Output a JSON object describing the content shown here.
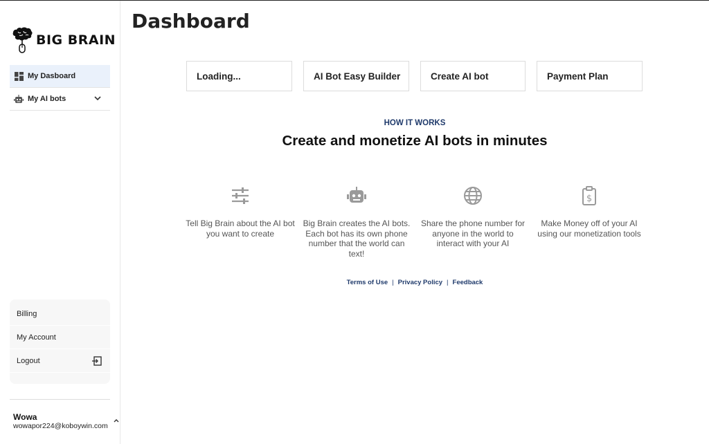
{
  "brand": {
    "name": "BIG BRAIN"
  },
  "sidebar": {
    "items": [
      {
        "label": "My Dasboard",
        "icon": "dashboard-icon"
      },
      {
        "label": "My AI bots",
        "icon": "robot-icon"
      }
    ],
    "bottom_items": [
      {
        "label": "Billing"
      },
      {
        "label": "My Account"
      },
      {
        "label": "Logout",
        "icon": "logout-icon"
      }
    ],
    "user": {
      "name": "Wowa",
      "email": "wowapor224@koboywin.com"
    }
  },
  "main": {
    "title": "Dashboard",
    "buttons": [
      {
        "label": "Loading..."
      },
      {
        "label": "AI Bot Easy Builder"
      },
      {
        "label": "Create AI bot"
      },
      {
        "label": "Payment Plan"
      }
    ],
    "how_it_works": {
      "label": "HOW IT WORKS",
      "heading": "Create and monetize AI bots in minutes",
      "steps": [
        {
          "icon": "sliders-icon",
          "text": "Tell Big Brain about the AI bot you want to create"
        },
        {
          "icon": "robot-icon",
          "text": "Big Brain creates the AI bots. Each bot has its own phone number that the world can text!"
        },
        {
          "icon": "globe-icon",
          "text": "Share the phone number for anyone in the world to interact with your AI"
        },
        {
          "icon": "money-clipboard-icon",
          "text": "Make Money off of your AI using our monetization tools"
        }
      ]
    },
    "footer": {
      "links": [
        "Terms of Use",
        "Privacy Policy",
        "Feedback"
      ],
      "separator": "|"
    }
  },
  "colors": {
    "accent_navy": "#1f3a6b",
    "active_nav_bg": "#eaf1fb",
    "icon_gray": "#9a9a9a"
  }
}
